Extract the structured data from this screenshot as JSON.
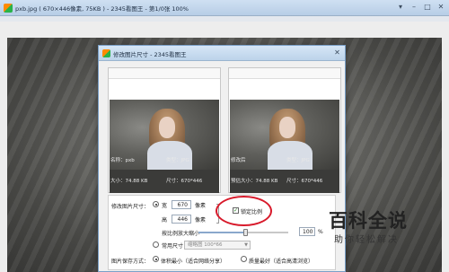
{
  "viewer": {
    "title": "pxb.jpg ( 670×446像素, 75KB ) - 2345看图王 - 第1/0张 100%"
  },
  "dialog": {
    "title": "修改图片尺寸 - 2345看图王"
  },
  "previews": {
    "left": {
      "name_label": "名称：pxb",
      "type_label": "类型：JPG",
      "size_label": "大小：74.88 KB",
      "dim_label": "尺寸：670*446"
    },
    "right": {
      "name_label": "修改后",
      "type_label": "类型：JPG",
      "size_label": "预估大小：74.88 KB",
      "dim_label": "尺寸：670*446"
    }
  },
  "settings": {
    "size_label": "修改图片尺寸：",
    "width_label": "宽",
    "width_value": "670",
    "height_label": "高",
    "height_value": "446",
    "unit": "像素",
    "lock_ratio": "锁定比例",
    "lock_checked": true,
    "scale_label": "按比例放大缩小",
    "scale_value": "100",
    "scale_unit": "%",
    "scale_fraction": 0.52,
    "common_label": "常用尺寸",
    "common_value": "缩略图 100*66",
    "save_label": "图片保存方式：",
    "save_option1": "体积最小（适合网络分享）",
    "save_option2": "质量最好（适合高清浏览）"
  },
  "watermark": {
    "title": "百科全说",
    "subtitle": "助你轻松解决"
  },
  "colors": {
    "highlight": "#d81a2b",
    "titlebar": "#c4d8ee",
    "accent": "#29b34a"
  }
}
